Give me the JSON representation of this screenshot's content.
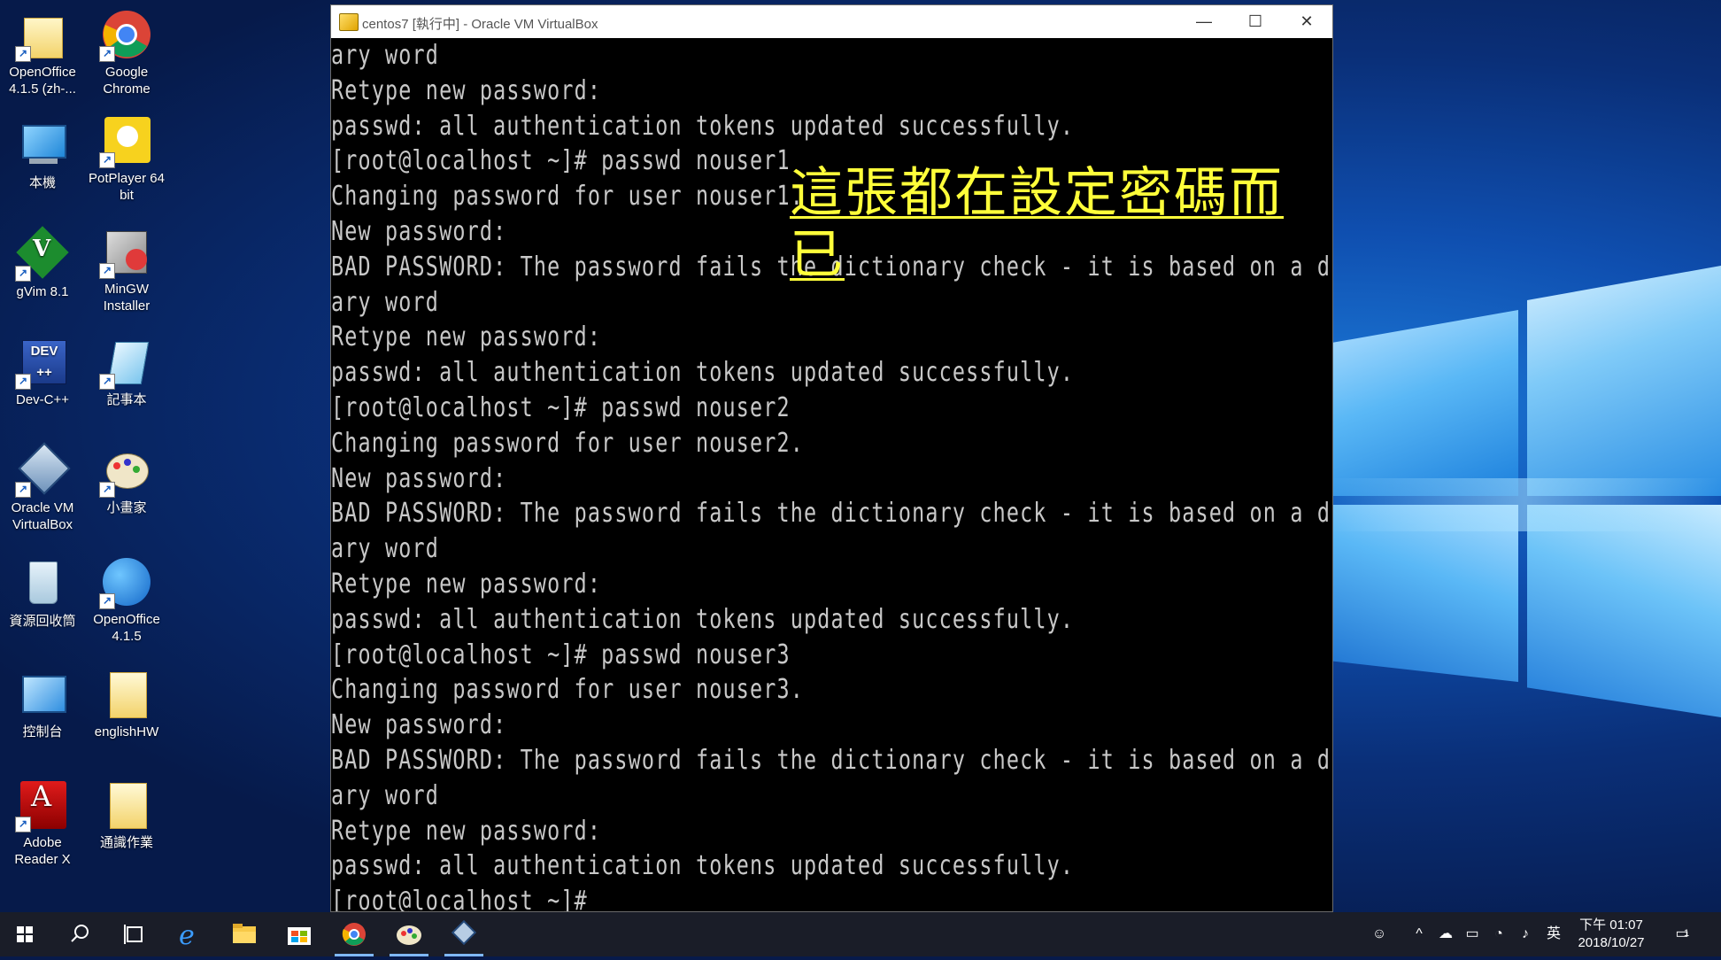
{
  "desktop": {
    "icons": [
      {
        "label": "OpenOffice\n4.1.5 (zh-...",
        "icon": "folder-icon"
      },
      {
        "label": "Google\nChrome",
        "icon": "chrome-icon"
      },
      {
        "label": "本機",
        "icon": "computer-icon"
      },
      {
        "label": "PotPlayer 64\nbit",
        "icon": "potplayer-icon"
      },
      {
        "label": "gVim 8.1",
        "icon": "gvim-icon"
      },
      {
        "label": "MinGW\nInstaller",
        "icon": "mingw-icon"
      },
      {
        "label": "Dev-C++",
        "icon": "devcpp-icon"
      },
      {
        "label": "記事本",
        "icon": "notepad-icon"
      },
      {
        "label": "Oracle VM\nVirtualBox",
        "icon": "virtualbox-icon"
      },
      {
        "label": "小畫家",
        "icon": "paint-icon"
      },
      {
        "label": "資源回收筒",
        "icon": "recycle-bin-icon"
      },
      {
        "label": "OpenOffice\n4.1.5",
        "icon": "openoffice-icon"
      },
      {
        "label": "控制台",
        "icon": "control-panel-icon"
      },
      {
        "label": "englishHW",
        "icon": "folder-icon"
      },
      {
        "label": "Adobe\nReader X",
        "icon": "adobe-reader-icon"
      },
      {
        "label": "通識作業",
        "icon": "folder-icon"
      }
    ]
  },
  "window": {
    "title": "centos7 [執行中] - Oracle VM VirtualBox",
    "minimize": "—",
    "maximize": "☐",
    "close": "✕"
  },
  "terminal": {
    "lines": [
      "ary word",
      "Retype new password:",
      "passwd: all authentication tokens updated successfully.",
      "[root@localhost ~]# passwd nouser1",
      "Changing password for user nouser1.",
      "New password:",
      "BAD PASSWORD: The password fails the dictionary check - it is based on a diction",
      "ary word",
      "Retype new password:",
      "passwd: all authentication tokens updated successfully.",
      "[root@localhost ~]# passwd nouser2",
      "Changing password for user nouser2.",
      "New password:",
      "BAD PASSWORD: The password fails the dictionary check - it is based on a diction",
      "ary word",
      "Retype new password:",
      "passwd: all authentication tokens updated successfully.",
      "[root@localhost ~]# passwd nouser3",
      "Changing password for user nouser3.",
      "New password:",
      "BAD PASSWORD: The password fails the dictionary check - it is based on a diction",
      "ary word",
      "Retype new password:",
      "passwd: all authentication tokens updated successfully.",
      "[root@localhost ~]#"
    ],
    "annotation": "這張都在設定密碼而已",
    "annotation_color": "#ffff3a"
  },
  "taskbar": {
    "items": [
      {
        "icon": "windows-start-icon"
      },
      {
        "icon": "search-icon"
      },
      {
        "icon": "task-view-icon"
      },
      {
        "icon": "edge-icon"
      },
      {
        "icon": "file-explorer-icon"
      },
      {
        "icon": "store-icon"
      },
      {
        "icon": "chrome-icon"
      },
      {
        "icon": "paint-icon"
      },
      {
        "icon": "virtualbox-icon"
      }
    ],
    "tray": {
      "ime": "英",
      "time": "下午 01:07",
      "date": "2018/10/27",
      "notification_count": "1"
    }
  }
}
